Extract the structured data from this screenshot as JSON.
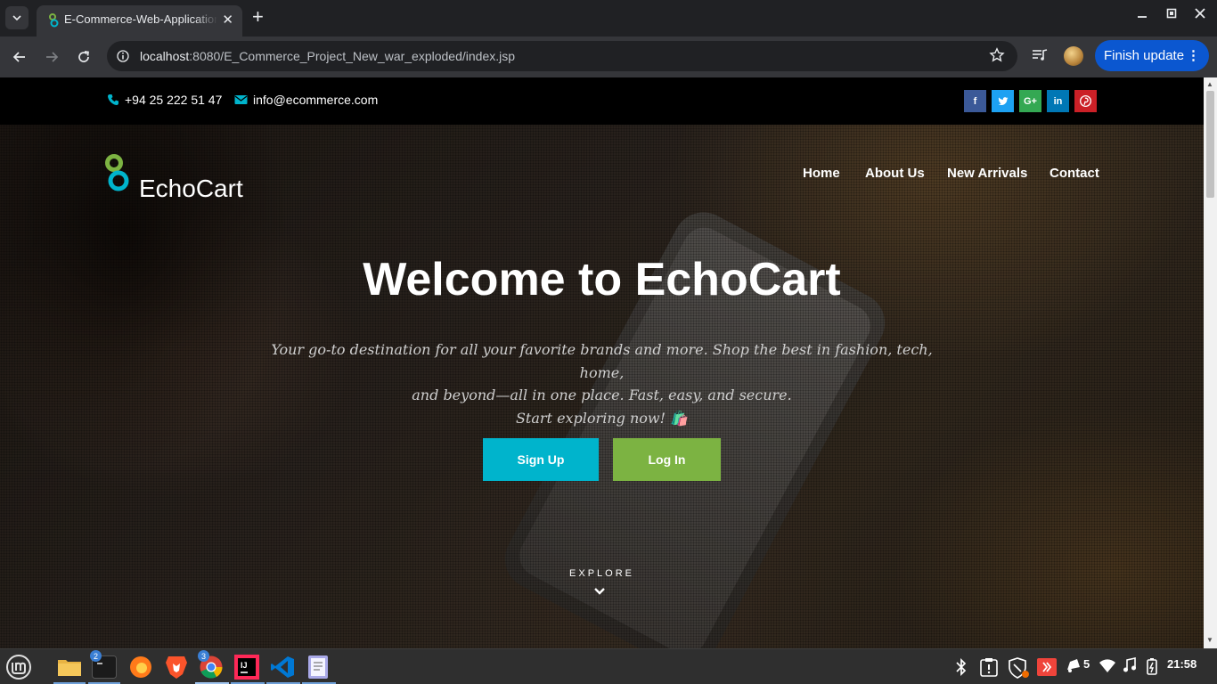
{
  "browser": {
    "tab_title": "E-Commerce-Web-Application",
    "url_host": "localhost",
    "url_path": ":8080/E_Commerce_Project_New_war_exploded/index.jsp",
    "update_label": "Finish update"
  },
  "topbar": {
    "phone": "+94 25 222 51 47",
    "email": "info@ecommerce.com",
    "social": [
      {
        "icon": "facebook-icon",
        "glyph": "f",
        "color": "#3b5998"
      },
      {
        "icon": "twitter-icon",
        "glyph": "t",
        "color": "#1da1f2"
      },
      {
        "icon": "google-plus-icon",
        "glyph": "G+",
        "color": "#34a853"
      },
      {
        "icon": "linkedin-icon",
        "glyph": "in",
        "color": "#0077b5"
      },
      {
        "icon": "pinterest-icon",
        "glyph": "P",
        "color": "#cb2027"
      }
    ]
  },
  "header": {
    "brand": "EchoCart",
    "nav": [
      "Home",
      "About Us",
      "New Arrivals",
      "Contact"
    ]
  },
  "hero": {
    "title": "Welcome to EchoCart",
    "tagline_line1": "Your go-to destination for all your favorite brands and more. Shop the best in fashion, tech, home,",
    "tagline_line2": "and beyond—all in one place. Fast, easy, and secure.",
    "tagline_line3": "Start exploring now! 🛍️",
    "signup_label": "Sign Up",
    "login_label": "Log In",
    "explore_label": "EXPLORE"
  },
  "colors": {
    "signup": "#00b4cc",
    "login": "#7cb342",
    "accent": "#00b4cc"
  },
  "taskbar": {
    "badges": {
      "terminal": "2",
      "chrome": "3"
    },
    "tray_notifications": "5",
    "clock": "21:58"
  }
}
